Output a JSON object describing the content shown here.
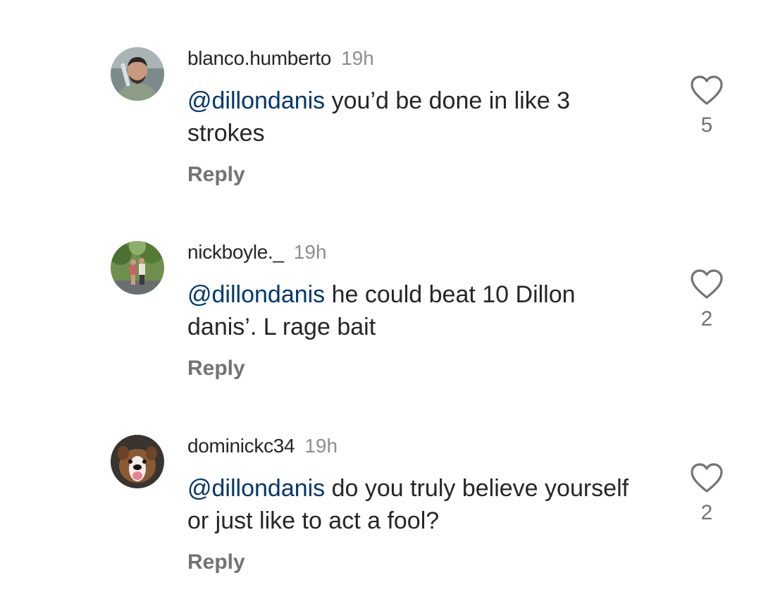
{
  "comments": [
    {
      "username": "blanco.humberto",
      "time": "19h",
      "mention": "@dillondanis",
      "text": " you’d be done in like 3 strokes",
      "reply_label": "Reply",
      "likes": "5"
    },
    {
      "username": "nickboyle._",
      "time": "19h",
      "mention": "@dillondanis",
      "text": " he could beat 10 Dillon danis’. L rage bait",
      "reply_label": "Reply",
      "likes": "2"
    },
    {
      "username": "dominickc34",
      "time": "19h",
      "mention": "@dillondanis",
      "text": " do you truly believe yourself or just like to act a fool?",
      "reply_label": "Reply",
      "likes": "2"
    }
  ],
  "icons": {
    "like": "heart-outline-icon"
  },
  "colors": {
    "mention": "#00376b",
    "secondary_text": "#737373",
    "timestamp": "#8e8e8e"
  }
}
